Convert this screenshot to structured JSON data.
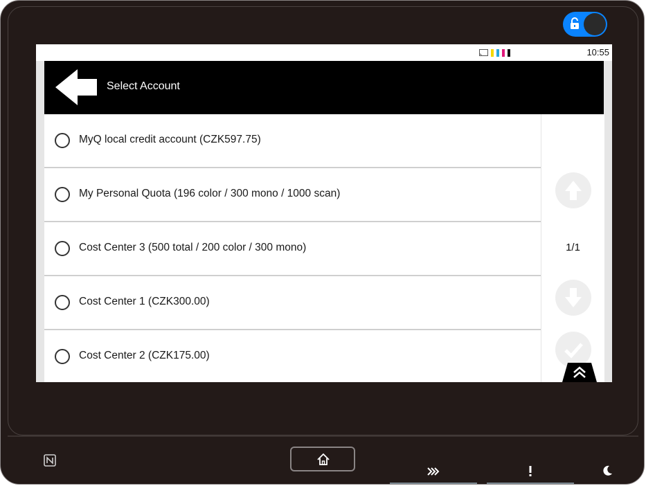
{
  "status_bar": {
    "time": "10:55"
  },
  "header": {
    "title": "Select Account"
  },
  "accounts": [
    {
      "label": "MyQ local credit account (CZK597.75)"
    },
    {
      "label": "My Personal Quota (196 color / 300 mono / 1000 scan)"
    },
    {
      "label": "Cost Center 3 (500 total / 200 color / 300 mono)"
    },
    {
      "label": "Cost Center 1 (CZK300.00)"
    },
    {
      "label": "Cost Center 2 (CZK175.00)"
    }
  ],
  "pagination": {
    "indicator": "1/1"
  },
  "colors": {
    "lock_toggle": "#0a84ff",
    "header_bg": "#000000",
    "toner_yellow": "#f5d800",
    "toner_cyan": "#29a8e0",
    "toner_magenta": "#e0187a",
    "toner_black": "#111111",
    "indicator_strip": "#7d8a94"
  },
  "icons": {
    "lock": "unlocked-padlock-icon",
    "back": "back-arrow-icon",
    "scroll_up": "arrow-up-icon",
    "scroll_down": "arrow-down-icon",
    "confirm": "checkmark-icon",
    "collapse": "double-chevron-up-icon",
    "nfc": "nfc-icon",
    "home": "home-icon",
    "data": "data-arrows-icon",
    "alert": "exclamation-icon",
    "sleep": "moon-icon",
    "cast": "cast-icon"
  }
}
